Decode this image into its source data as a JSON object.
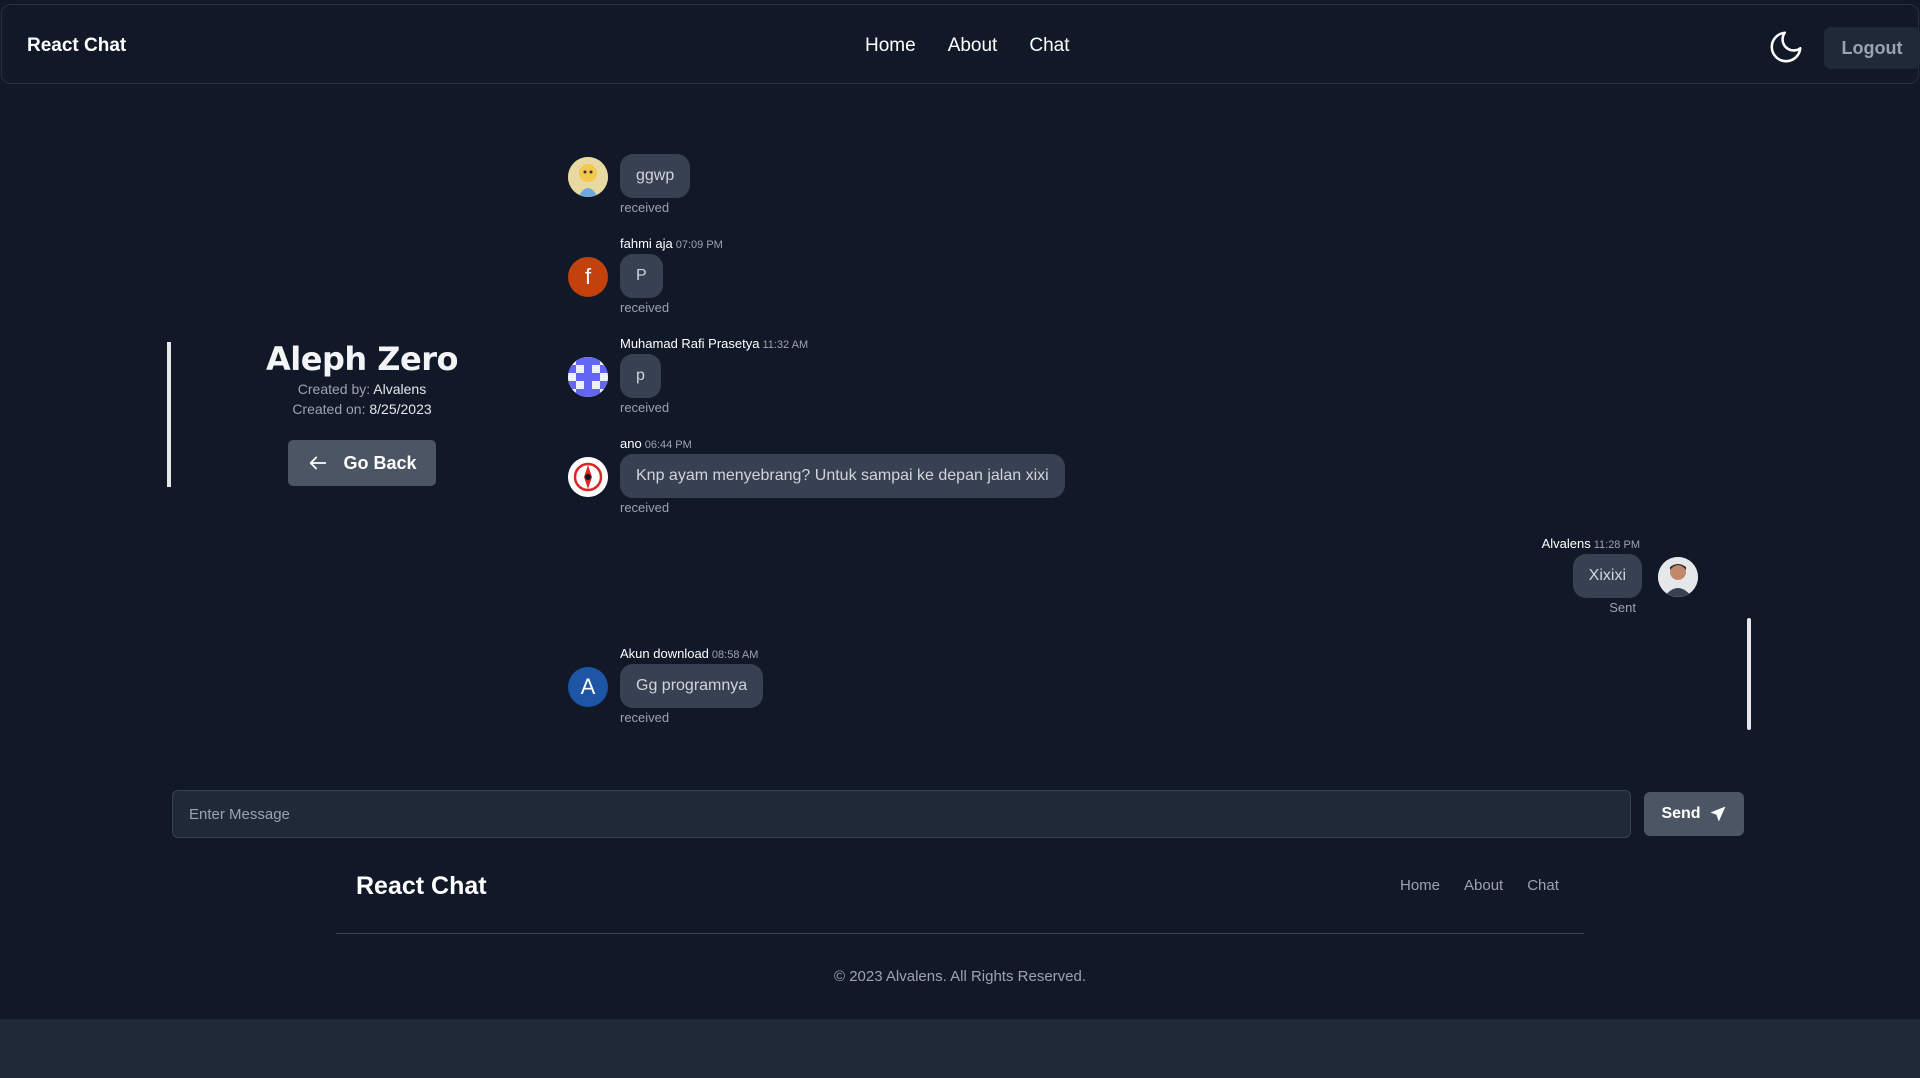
{
  "navbar": {
    "brand": "React Chat",
    "links": [
      "Home",
      "About",
      "Chat"
    ],
    "theme_icon": "moon-icon",
    "logout_label": "Logout"
  },
  "room": {
    "title": "Aleph Zero",
    "created_by_label": "Created by:",
    "created_by": "Alvalens",
    "created_on_label": "Created on:",
    "created_on": "8/25/2023",
    "go_back_label": "Go Back"
  },
  "messages": [
    {
      "sender": "",
      "time": "",
      "text": "ggwp",
      "status": "received",
      "avatar_icon": "cartoon-avatar-icon"
    },
    {
      "sender": "fahmi aja",
      "time": "07:09 PM",
      "text": "P",
      "status": "received",
      "avatar_letter": "f",
      "avatar_color": "#c2410c"
    },
    {
      "sender": "Muhamad Rafi Prasetya",
      "time": "11:32 AM",
      "text": "p",
      "status": "received",
      "avatar_icon": "pattern-avatar-icon",
      "avatar_color": "#6366f1"
    },
    {
      "sender": "ano",
      "time": "06:44 PM",
      "text": "Knp ayam menyebrang? Untuk sampai ke depan jalan xixi",
      "status": "received",
      "avatar_icon": "emblem-avatar-icon",
      "avatar_color": "#dc2626"
    },
    {
      "sender": "Alvalens",
      "time": "11:28 PM",
      "text": "Xixixi",
      "status": "Sent",
      "avatar_icon": "photo-avatar-icon"
    },
    {
      "sender": "Akun download",
      "time": "08:58 AM",
      "text": "Gg programnya",
      "status": "received",
      "avatar_letter": "A",
      "avatar_color": "#1e55a5"
    }
  ],
  "composer": {
    "placeholder": "Enter Message",
    "send_label": "Send",
    "send_icon": "paper-plane-icon"
  },
  "footer": {
    "brand": "React Chat",
    "links": [
      "Home",
      "About",
      "Chat"
    ],
    "copyright": "© 2023 Alvalens. All Rights Reserved."
  },
  "colors": {
    "background": "#111827",
    "bubble": "#374151",
    "button": "#4b5563",
    "panel": "#1f2937"
  }
}
